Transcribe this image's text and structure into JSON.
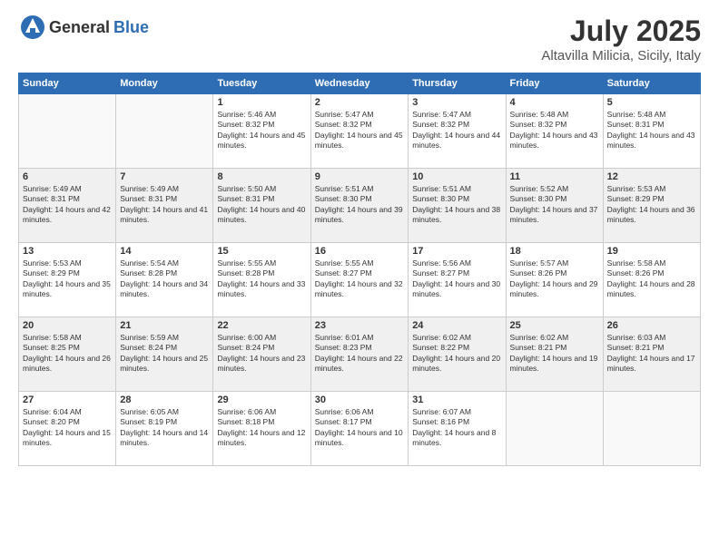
{
  "header": {
    "logo_general": "General",
    "logo_blue": "Blue",
    "month": "July 2025",
    "location": "Altavilla Milicia, Sicily, Italy"
  },
  "weekdays": [
    "Sunday",
    "Monday",
    "Tuesday",
    "Wednesday",
    "Thursday",
    "Friday",
    "Saturday"
  ],
  "weeks": [
    [
      {
        "day": null
      },
      {
        "day": null
      },
      {
        "day": "1",
        "sunrise": "Sunrise: 5:46 AM",
        "sunset": "Sunset: 8:32 PM",
        "daylight": "Daylight: 14 hours and 45 minutes."
      },
      {
        "day": "2",
        "sunrise": "Sunrise: 5:47 AM",
        "sunset": "Sunset: 8:32 PM",
        "daylight": "Daylight: 14 hours and 45 minutes."
      },
      {
        "day": "3",
        "sunrise": "Sunrise: 5:47 AM",
        "sunset": "Sunset: 8:32 PM",
        "daylight": "Daylight: 14 hours and 44 minutes."
      },
      {
        "day": "4",
        "sunrise": "Sunrise: 5:48 AM",
        "sunset": "Sunset: 8:32 PM",
        "daylight": "Daylight: 14 hours and 43 minutes."
      },
      {
        "day": "5",
        "sunrise": "Sunrise: 5:48 AM",
        "sunset": "Sunset: 8:31 PM",
        "daylight": "Daylight: 14 hours and 43 minutes."
      }
    ],
    [
      {
        "day": "6",
        "sunrise": "Sunrise: 5:49 AM",
        "sunset": "Sunset: 8:31 PM",
        "daylight": "Daylight: 14 hours and 42 minutes."
      },
      {
        "day": "7",
        "sunrise": "Sunrise: 5:49 AM",
        "sunset": "Sunset: 8:31 PM",
        "daylight": "Daylight: 14 hours and 41 minutes."
      },
      {
        "day": "8",
        "sunrise": "Sunrise: 5:50 AM",
        "sunset": "Sunset: 8:31 PM",
        "daylight": "Daylight: 14 hours and 40 minutes."
      },
      {
        "day": "9",
        "sunrise": "Sunrise: 5:51 AM",
        "sunset": "Sunset: 8:30 PM",
        "daylight": "Daylight: 14 hours and 39 minutes."
      },
      {
        "day": "10",
        "sunrise": "Sunrise: 5:51 AM",
        "sunset": "Sunset: 8:30 PM",
        "daylight": "Daylight: 14 hours and 38 minutes."
      },
      {
        "day": "11",
        "sunrise": "Sunrise: 5:52 AM",
        "sunset": "Sunset: 8:30 PM",
        "daylight": "Daylight: 14 hours and 37 minutes."
      },
      {
        "day": "12",
        "sunrise": "Sunrise: 5:53 AM",
        "sunset": "Sunset: 8:29 PM",
        "daylight": "Daylight: 14 hours and 36 minutes."
      }
    ],
    [
      {
        "day": "13",
        "sunrise": "Sunrise: 5:53 AM",
        "sunset": "Sunset: 8:29 PM",
        "daylight": "Daylight: 14 hours and 35 minutes."
      },
      {
        "day": "14",
        "sunrise": "Sunrise: 5:54 AM",
        "sunset": "Sunset: 8:28 PM",
        "daylight": "Daylight: 14 hours and 34 minutes."
      },
      {
        "day": "15",
        "sunrise": "Sunrise: 5:55 AM",
        "sunset": "Sunset: 8:28 PM",
        "daylight": "Daylight: 14 hours and 33 minutes."
      },
      {
        "day": "16",
        "sunrise": "Sunrise: 5:55 AM",
        "sunset": "Sunset: 8:27 PM",
        "daylight": "Daylight: 14 hours and 32 minutes."
      },
      {
        "day": "17",
        "sunrise": "Sunrise: 5:56 AM",
        "sunset": "Sunset: 8:27 PM",
        "daylight": "Daylight: 14 hours and 30 minutes."
      },
      {
        "day": "18",
        "sunrise": "Sunrise: 5:57 AM",
        "sunset": "Sunset: 8:26 PM",
        "daylight": "Daylight: 14 hours and 29 minutes."
      },
      {
        "day": "19",
        "sunrise": "Sunrise: 5:58 AM",
        "sunset": "Sunset: 8:26 PM",
        "daylight": "Daylight: 14 hours and 28 minutes."
      }
    ],
    [
      {
        "day": "20",
        "sunrise": "Sunrise: 5:58 AM",
        "sunset": "Sunset: 8:25 PM",
        "daylight": "Daylight: 14 hours and 26 minutes."
      },
      {
        "day": "21",
        "sunrise": "Sunrise: 5:59 AM",
        "sunset": "Sunset: 8:24 PM",
        "daylight": "Daylight: 14 hours and 25 minutes."
      },
      {
        "day": "22",
        "sunrise": "Sunrise: 6:00 AM",
        "sunset": "Sunset: 8:24 PM",
        "daylight": "Daylight: 14 hours and 23 minutes."
      },
      {
        "day": "23",
        "sunrise": "Sunrise: 6:01 AM",
        "sunset": "Sunset: 8:23 PM",
        "daylight": "Daylight: 14 hours and 22 minutes."
      },
      {
        "day": "24",
        "sunrise": "Sunrise: 6:02 AM",
        "sunset": "Sunset: 8:22 PM",
        "daylight": "Daylight: 14 hours and 20 minutes."
      },
      {
        "day": "25",
        "sunrise": "Sunrise: 6:02 AM",
        "sunset": "Sunset: 8:21 PM",
        "daylight": "Daylight: 14 hours and 19 minutes."
      },
      {
        "day": "26",
        "sunrise": "Sunrise: 6:03 AM",
        "sunset": "Sunset: 8:21 PM",
        "daylight": "Daylight: 14 hours and 17 minutes."
      }
    ],
    [
      {
        "day": "27",
        "sunrise": "Sunrise: 6:04 AM",
        "sunset": "Sunset: 8:20 PM",
        "daylight": "Daylight: 14 hours and 15 minutes."
      },
      {
        "day": "28",
        "sunrise": "Sunrise: 6:05 AM",
        "sunset": "Sunset: 8:19 PM",
        "daylight": "Daylight: 14 hours and 14 minutes."
      },
      {
        "day": "29",
        "sunrise": "Sunrise: 6:06 AM",
        "sunset": "Sunset: 8:18 PM",
        "daylight": "Daylight: 14 hours and 12 minutes."
      },
      {
        "day": "30",
        "sunrise": "Sunrise: 6:06 AM",
        "sunset": "Sunset: 8:17 PM",
        "daylight": "Daylight: 14 hours and 10 minutes."
      },
      {
        "day": "31",
        "sunrise": "Sunrise: 6:07 AM",
        "sunset": "Sunset: 8:16 PM",
        "daylight": "Daylight: 14 hours and 8 minutes."
      },
      {
        "day": null
      },
      {
        "day": null
      }
    ]
  ]
}
